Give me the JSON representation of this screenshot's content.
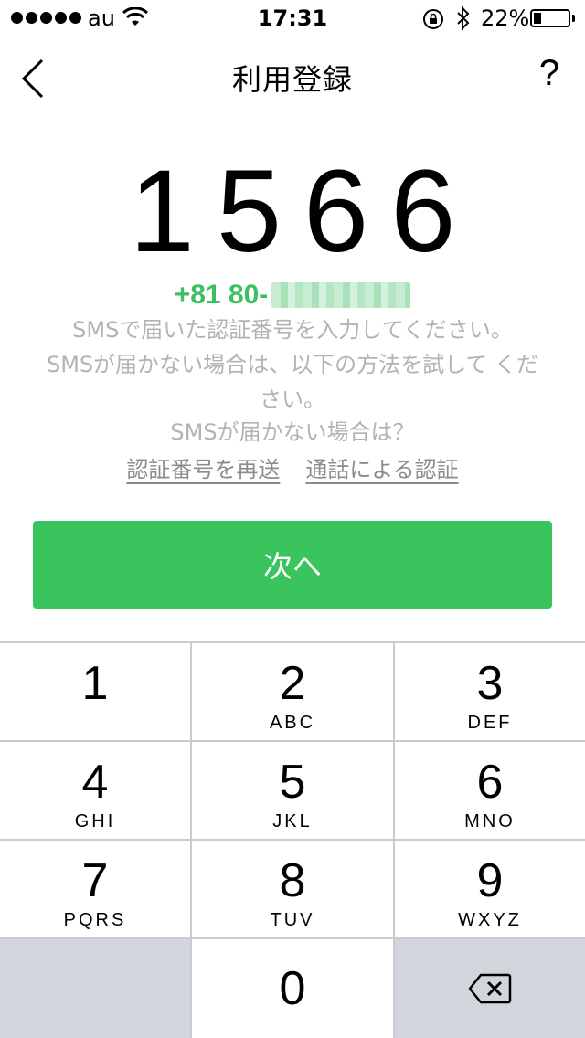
{
  "status_bar": {
    "carrier": "au",
    "time": "17:31",
    "battery_percent": "22%",
    "battery_level": 0.22,
    "icons": [
      "signal-dots",
      "wifi-icon",
      "rotation-lock-icon",
      "bluetooth-icon",
      "battery-icon"
    ]
  },
  "nav": {
    "title": "利用登録",
    "back_icon": "chevron-left-icon",
    "help_label": "?"
  },
  "verification": {
    "code": "1566",
    "phone_number": "+81 80-",
    "instructions": [
      "SMSで届いた認証番号を入力してください。",
      "SMSが届かない場合は、以下の方法を試して ください。",
      "SMSが届かない場合は？"
    ],
    "resend_link": "認証番号を再送",
    "call_link": "通話による認証"
  },
  "next_button": {
    "label": "次へ",
    "color": "#3ac45e"
  },
  "keypad": {
    "keys": [
      {
        "num": "1",
        "letters": ""
      },
      {
        "num": "2",
        "letters": "ABC"
      },
      {
        "num": "3",
        "letters": "DEF"
      },
      {
        "num": "4",
        "letters": "GHI"
      },
      {
        "num": "5",
        "letters": "JKL"
      },
      {
        "num": "6",
        "letters": "MNO"
      },
      {
        "num": "7",
        "letters": "PQRS"
      },
      {
        "num": "8",
        "letters": "TUV"
      },
      {
        "num": "9",
        "letters": "WXYZ"
      },
      {
        "num": "0",
        "letters": ""
      }
    ],
    "delete_icon": "backspace-icon"
  },
  "colors": {
    "accent_green": "#3cbf5e",
    "hint_gray": "#b3b3b3",
    "keypad_bg": "#c8cbd0"
  }
}
